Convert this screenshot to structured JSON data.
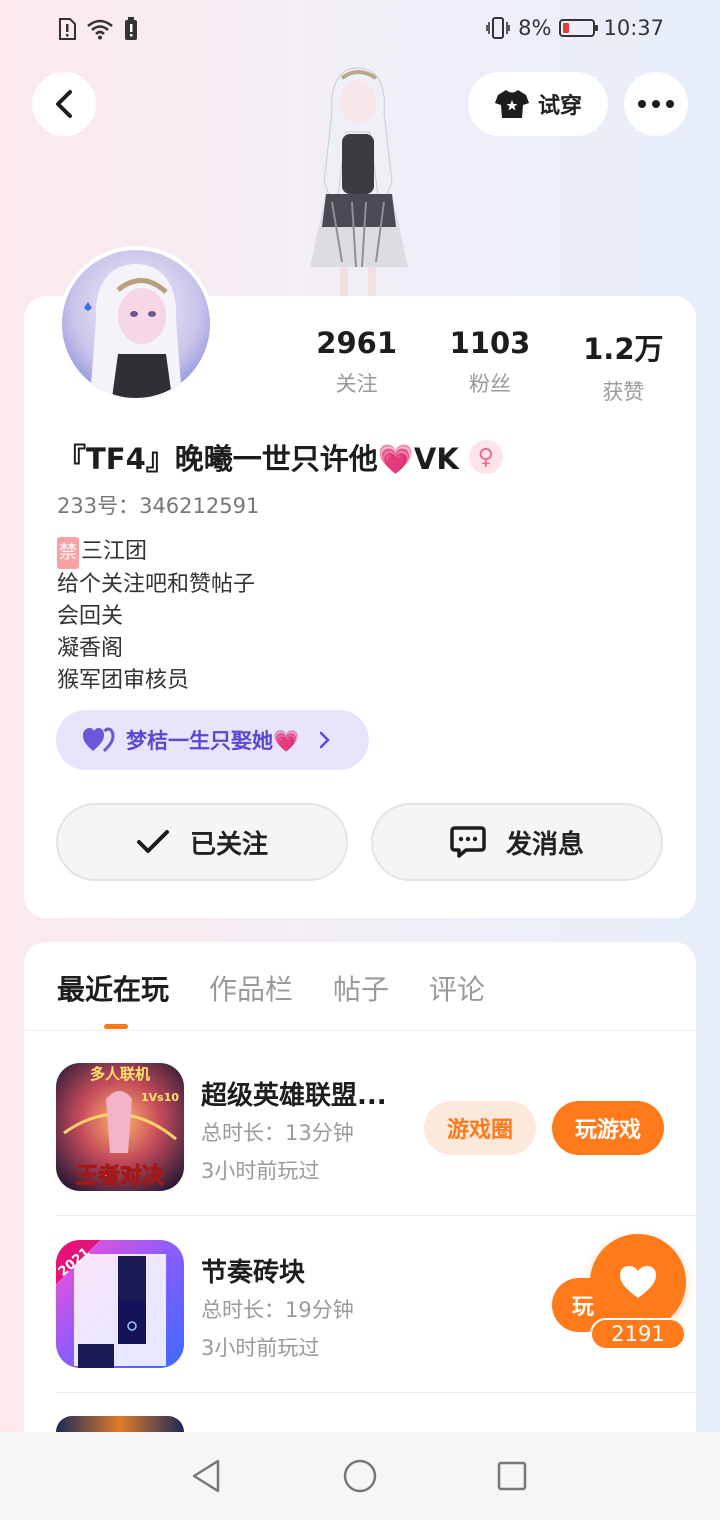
{
  "status_bar": {
    "battery": "8%",
    "time": "10:37"
  },
  "header": {
    "try_on_label": "试穿"
  },
  "profile": {
    "stats": [
      {
        "value": "2961",
        "label": "关注"
      },
      {
        "value": "1103",
        "label": "粉丝"
      },
      {
        "value": "1.2万",
        "label": "获赞"
      }
    ],
    "nickname": "『TF4』晚曦一世只许他💗VK",
    "uid": "233号：346212591",
    "bio_ban_tag": "禁",
    "bio_lines": [
      "三江团",
      "给个关注吧和赞帖子",
      "会回关",
      "凝香阁",
      "猴军团审核员"
    ],
    "cp_label": "梦桔一生只娶她💗",
    "follow_label": "已关注",
    "message_label": "发消息"
  },
  "tabs": [
    {
      "label": "最近在玩",
      "active": true
    },
    {
      "label": "作品栏",
      "active": false
    },
    {
      "label": "帖子",
      "active": false
    },
    {
      "label": "评论",
      "active": false
    }
  ],
  "games": [
    {
      "title": "超级英雄联盟...",
      "duration": "总时长：13分钟",
      "last_played": "3小时前玩过",
      "circle_label": "游戏圈",
      "play_label": "玩游戏",
      "icon_text_top": "多人联机",
      "icon_text_badge": "1Vs10",
      "icon_text_bottom": "王者对决"
    },
    {
      "title": "节奏砖块",
      "duration": "总时长：19分钟",
      "last_played": "3小时前玩过",
      "play_label_partial": "玩",
      "icon_badge": "2021"
    }
  ],
  "like_fab": {
    "count": "2191"
  },
  "colors": {
    "accent": "#ff7a1a",
    "accent_light": "#fde8dc",
    "cp_bg": "#e7e4fb",
    "cp_text": "#5b4ad1"
  }
}
